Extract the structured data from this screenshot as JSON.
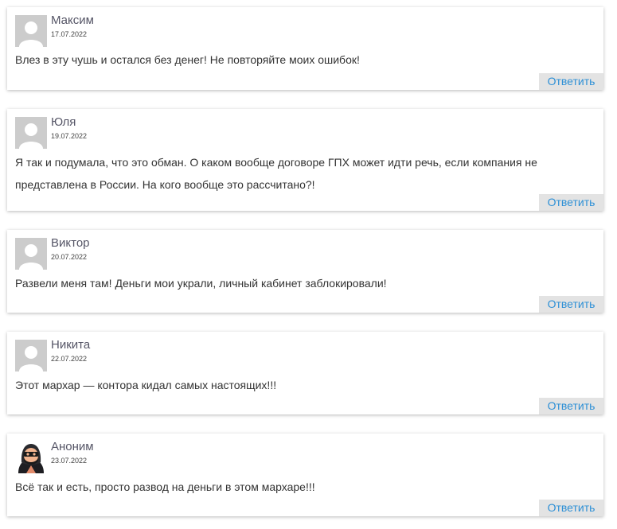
{
  "comments": [
    {
      "author": "Максим",
      "date": "17.07.2022",
      "text": "Влез в эту чушь и остался без денег! Не повторяйте моих ошибок!",
      "reply": "Ответить",
      "avatar": "default-avatar-icon"
    },
    {
      "author": "Юля",
      "date": "19.07.2022",
      "text": "Я так и подумала, что это обман. О каком вообще договоре ГПХ может идти речь, если компания не представлена в России. На кого вообще это рассчитано?!",
      "reply": "Ответить",
      "avatar": "default-avatar-icon"
    },
    {
      "author": "Виктор",
      "date": "20.07.2022",
      "text": "Развели меня там! Деньги мои украли, личный кабинет заблокировали!",
      "reply": "Ответить",
      "avatar": "default-avatar-icon"
    },
    {
      "author": "Никита",
      "date": "22.07.2022",
      "text": "Этот мархар — контора кидал самых настоящих!!!",
      "reply": "Ответить",
      "avatar": "default-avatar-icon"
    },
    {
      "author": "Аноним",
      "date": "23.07.2022",
      "text": "Всё так и есть, просто развод на деньги в этом мархаре!!!",
      "reply": "Ответить",
      "avatar": "hooded-thief-avatar-icon"
    }
  ],
  "colors": {
    "author": "#555566",
    "reply_text": "#2e90d6",
    "reply_bg": "#e3e3e3",
    "avatar_bg": "#cccccc"
  }
}
